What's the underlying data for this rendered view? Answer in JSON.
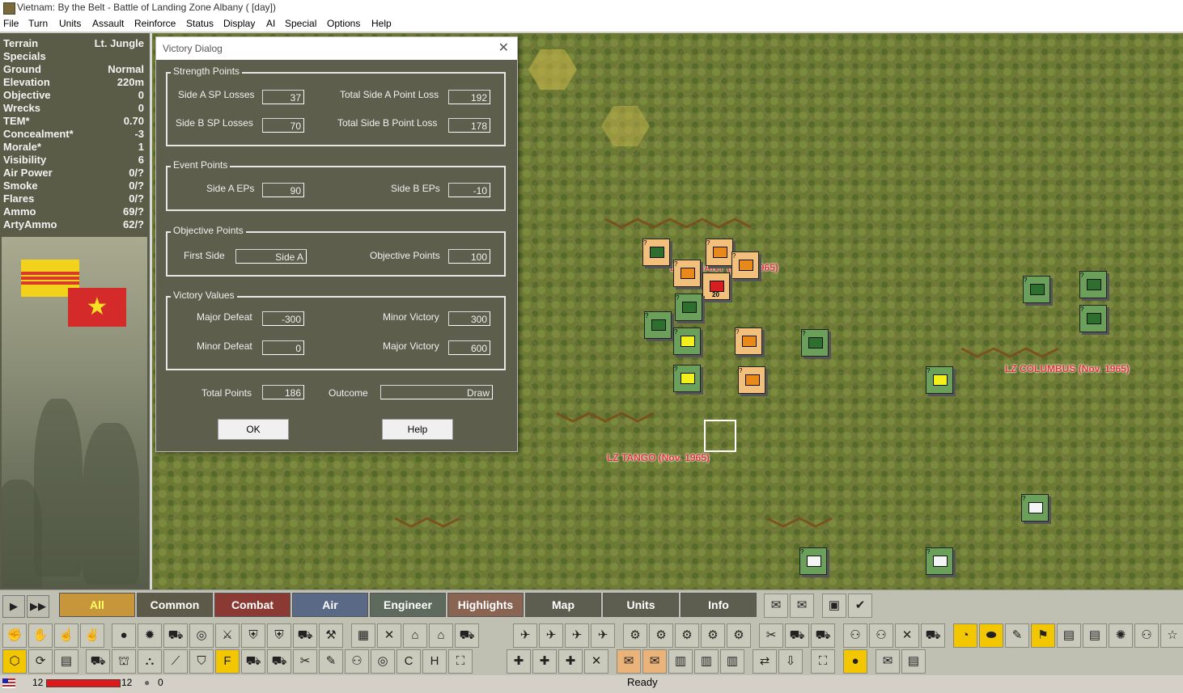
{
  "window": {
    "title": "Vietnam: By the Belt - Battle of Landing Zone Albany ( [day])"
  },
  "menu": [
    "File",
    "Turn",
    "Units",
    "Assault",
    "Reinforce",
    "Status",
    "Display",
    "AI",
    "Special",
    "Options",
    "Help"
  ],
  "hex_info": [
    {
      "label": "Terrain",
      "value": "Lt. Jungle"
    },
    {
      "label": "Specials",
      "value": ""
    },
    {
      "label": "Ground",
      "value": "Normal"
    },
    {
      "label": "Elevation",
      "value": "220m"
    },
    {
      "label": "Objective",
      "value": "0"
    },
    {
      "label": "Wrecks",
      "value": "0"
    },
    {
      "label": "TEM*",
      "value": "0.70"
    },
    {
      "label": "Concealment*",
      "value": "-3"
    },
    {
      "label": "Morale*",
      "value": "1"
    },
    {
      "label": "Visibility",
      "value": "6"
    },
    {
      "label": "Air Power",
      "value": "0/?"
    },
    {
      "label": "Smoke",
      "value": "0/?"
    },
    {
      "label": "Flares",
      "value": "0/?"
    },
    {
      "label": "Ammo",
      "value": "69/?"
    },
    {
      "label": "ArtyAmmo",
      "value": "62/?"
    }
  ],
  "flags": {
    "vietnam_star": "★"
  },
  "map": {
    "labels": [
      "LZ ALBANY (Nov. 1965)",
      "LZ COLUMBUS (Nov. 1965)",
      "LZ TANGO (Nov. 1965)"
    ],
    "stack_number": "20",
    "unit_marks": [
      "?",
      "?",
      "?",
      "?",
      "?",
      "?",
      "?",
      "?",
      "?",
      "?",
      "?",
      "?",
      "?",
      "?",
      "?",
      "?",
      "?",
      "?"
    ]
  },
  "dialog": {
    "title": "Victory Dialog",
    "close": "✕",
    "strength": {
      "heading": "Strength Points",
      "a_losses_label": "Side A SP Losses",
      "a_losses": "37",
      "a_total_label": "Total Side A Point Loss",
      "a_total": "192",
      "b_losses_label": "Side B SP Losses",
      "b_losses": "70",
      "b_total_label": "Total Side B Point Loss",
      "b_total": "178"
    },
    "events": {
      "heading": "Event Points",
      "a_label": "Side A EPs",
      "a": "90",
      "b_label": "Side B EPs",
      "b": "-10"
    },
    "objective": {
      "heading": "Objective Points",
      "first_side_label": "First Side",
      "first_side": "Side A",
      "points_label": "Objective Points",
      "points": "100"
    },
    "victory": {
      "heading": "Victory Values",
      "major_defeat_label": "Major Defeat",
      "major_defeat": "-300",
      "minor_victory_label": "Minor Victory",
      "minor_victory": "300",
      "minor_defeat_label": "Minor Defeat",
      "minor_defeat": "0",
      "major_victory_label": "Major Victory",
      "major_victory": "600"
    },
    "total_label": "Total Points",
    "total": "186",
    "outcome_label": "Outcome",
    "outcome": "Draw",
    "ok": "OK",
    "help": "Help"
  },
  "toolbar": {
    "play": "▶",
    "fast": "▶▶",
    "categories": [
      {
        "label": "All",
        "color": "#c8963a"
      },
      {
        "label": "Common",
        "color": "#5e5a4a"
      },
      {
        "label": "Combat",
        "color": "#8a3a32"
      },
      {
        "label": "Air",
        "color": "#5a6a86"
      },
      {
        "label": "Engineer",
        "color": "#5d6a5d"
      },
      {
        "label": "Highlights",
        "color": "#8a6452"
      },
      {
        "label": "Map",
        "color": "#5e5e50"
      },
      {
        "label": "Units",
        "color": "#5e5e50"
      },
      {
        "label": "Info",
        "color": "#5e5e50"
      }
    ],
    "accent": "#c8963a"
  },
  "status": {
    "left_a": "12",
    "left_b": "12",
    "ammo": "0",
    "center": "Ready",
    "strength_fraction": 1.0
  }
}
